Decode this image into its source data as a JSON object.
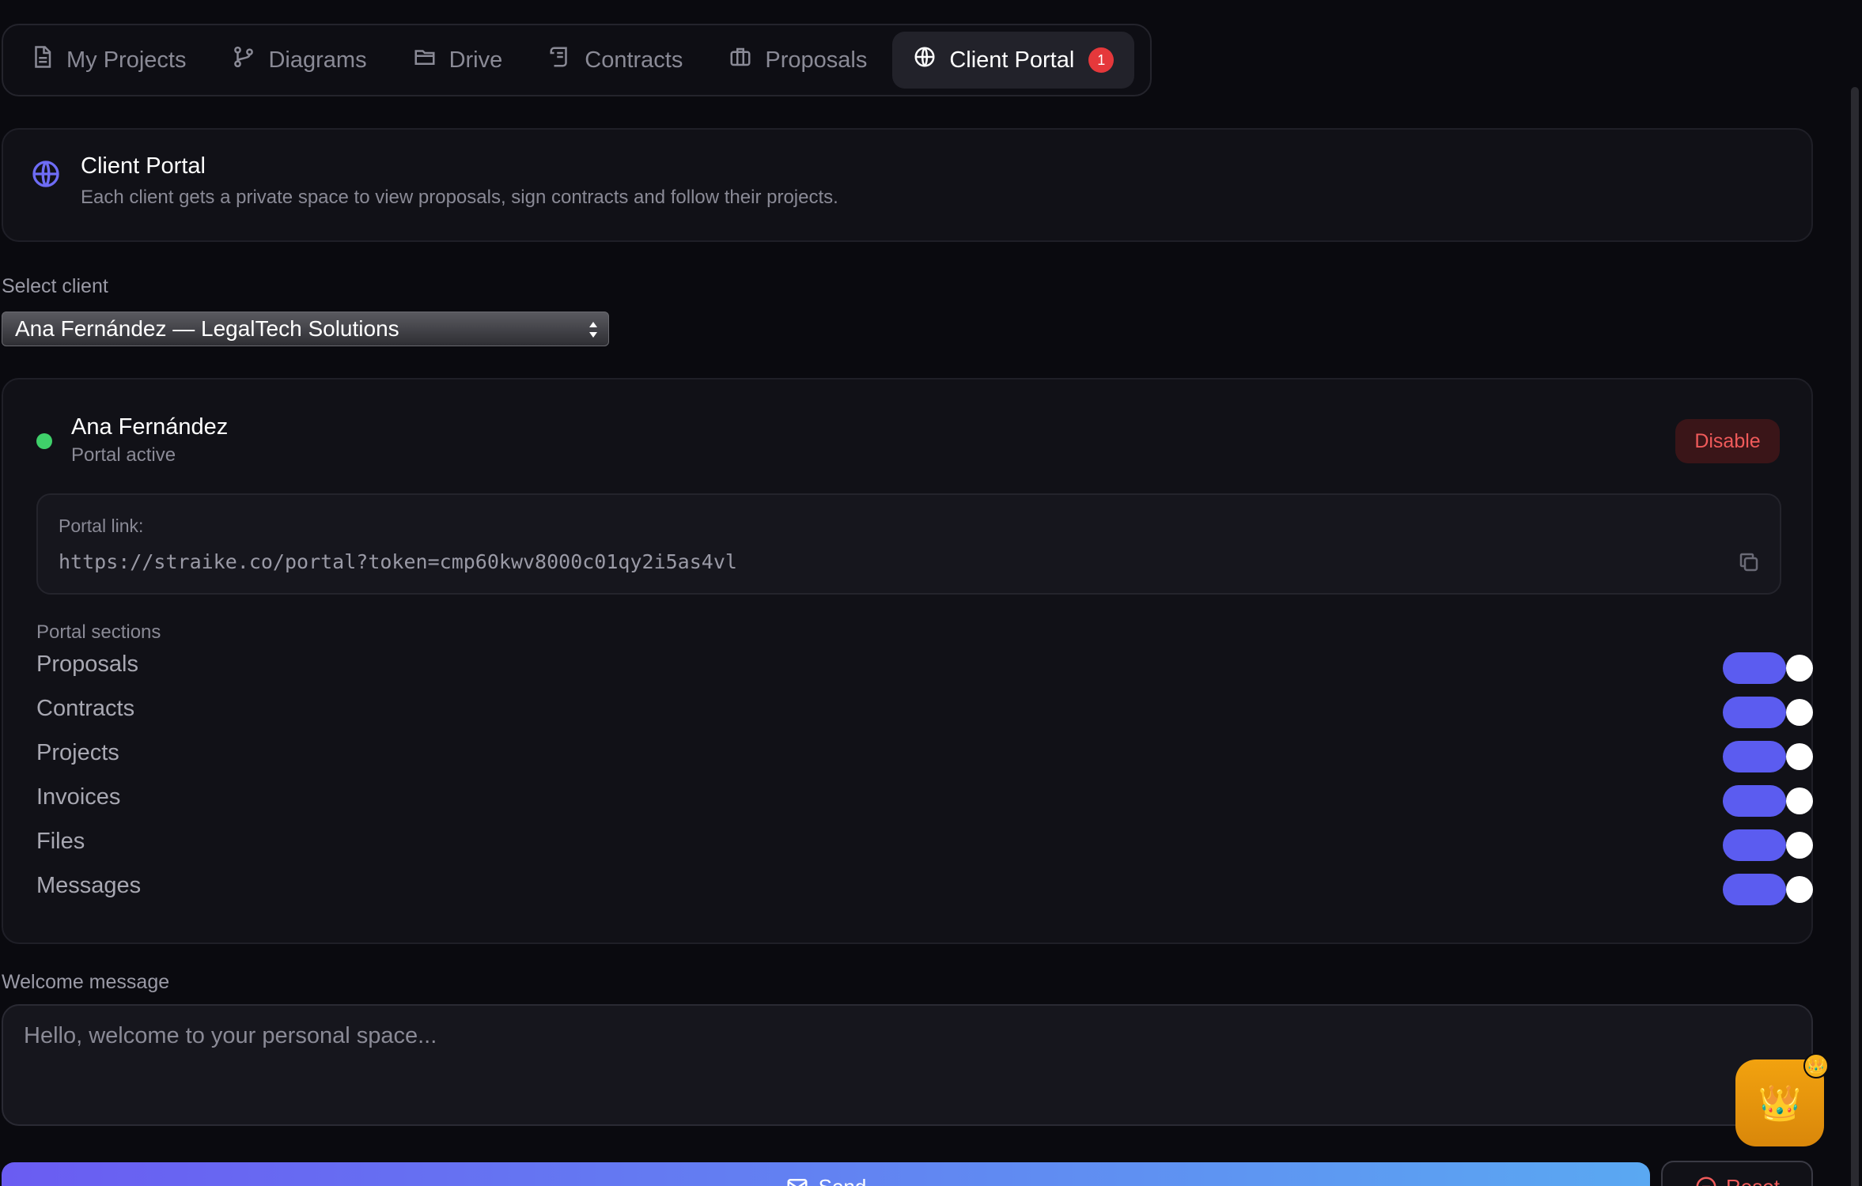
{
  "tabs": [
    {
      "label": "My Projects",
      "icon": "document-icon"
    },
    {
      "label": "Diagrams",
      "icon": "git-branch-icon"
    },
    {
      "label": "Drive",
      "icon": "folder-icon"
    },
    {
      "label": "Contracts",
      "icon": "scroll-icon"
    },
    {
      "label": "Proposals",
      "icon": "briefcase-icon"
    },
    {
      "label": "Client Portal",
      "icon": "globe-icon",
      "badge": "1",
      "active": true
    }
  ],
  "info": {
    "title": "Client Portal",
    "description": "Each client gets a private space to view proposals, sign contracts and follow their projects."
  },
  "select_client": {
    "label": "Select client",
    "value": "Ana Fernández — LegalTech Solutions"
  },
  "client": {
    "name": "Ana Fernández",
    "status": "Portal active",
    "status_color": "#3fd06a",
    "disable_label": "Disable",
    "portal_link_label": "Portal link:",
    "portal_link": "https://straike.co/portal?token=cmp60kwv8000c01qy2i5as4vl"
  },
  "portal_sections": {
    "label": "Portal sections",
    "items": [
      {
        "name": "Proposals",
        "enabled": true
      },
      {
        "name": "Contracts",
        "enabled": true
      },
      {
        "name": "Projects",
        "enabled": true
      },
      {
        "name": "Invoices",
        "enabled": true
      },
      {
        "name": "Files",
        "enabled": true
      },
      {
        "name": "Messages",
        "enabled": true
      }
    ]
  },
  "welcome": {
    "label": "Welcome message",
    "placeholder": "Hello, welcome to your personal space..."
  },
  "fab": {
    "icon": "crown-icon",
    "emoji": "👑",
    "badge_emoji": "👑"
  },
  "actions": {
    "send_label": "Send",
    "reset_label": "Reset"
  },
  "colors": {
    "accent": "#5b5cf0",
    "danger": "#ef5a5a",
    "badge": "#e5383b",
    "fab": "#f2a20f"
  }
}
